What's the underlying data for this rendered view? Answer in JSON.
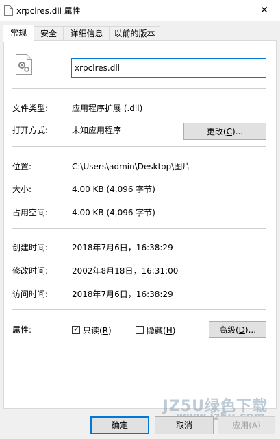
{
  "window": {
    "title": "xrpclres.dll 属性",
    "close_glyph": "✕"
  },
  "tabs": [
    {
      "label": "常规",
      "active": true
    },
    {
      "label": "安全",
      "active": false
    },
    {
      "label": "详细信息",
      "active": false
    },
    {
      "label": "以前的版本",
      "active": false
    }
  ],
  "file": {
    "name": "xrpclres.dll",
    "icon": "dll-file-icon"
  },
  "type": {
    "label": "文件类型:",
    "value": "应用程序扩展 (.dll)"
  },
  "opens_with": {
    "label": "打开方式:",
    "value": "未知应用程序",
    "button_text": "更改(",
    "button_key": "C",
    "button_tail": ")..."
  },
  "location": {
    "label": "位置:",
    "value": "C:\\Users\\admin\\Desktop\\图片"
  },
  "size": {
    "label": "大小:",
    "value": "4.00 KB (4,096 字节)"
  },
  "size_on_disk": {
    "label": "占用空间:",
    "value": "4.00 KB (4,096 字节)"
  },
  "created": {
    "label": "创建时间:",
    "value": "2018年7月6日，16:38:29"
  },
  "modified": {
    "label": "修改时间:",
    "value": "2002年8月18日，16:31:00"
  },
  "accessed": {
    "label": "访问时间:",
    "value": "2018年7月6日，16:38:29"
  },
  "attributes": {
    "label": "属性:",
    "readonly": {
      "text": "只读(",
      "key": "R",
      "tail": ")",
      "checked": true,
      "check_glyph": "✓"
    },
    "hidden": {
      "text": "隐藏(",
      "key": "H",
      "tail": ")",
      "checked": false
    },
    "advanced_text": "高级(",
    "advanced_key": "D",
    "advanced_tail": ")..."
  },
  "footer": {
    "ok": "确定",
    "cancel": "取消",
    "apply_text": "应用(",
    "apply_key": "A",
    "apply_tail": ")"
  },
  "watermark": {
    "line1": "JZ5U绿色下载",
    "line2": "www.jz5u.com"
  },
  "colors": {
    "accent": "#0078d7"
  }
}
